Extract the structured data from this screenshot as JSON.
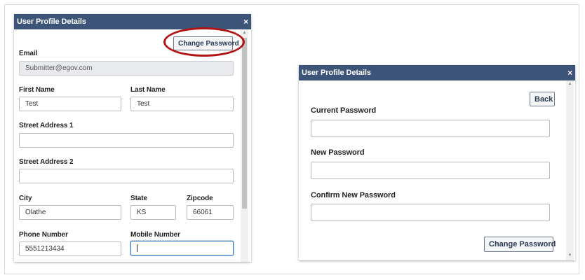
{
  "left_dialog": {
    "title": "User Profile Details",
    "close_glyph": "×",
    "change_password_label": "Change Password",
    "email": {
      "label": "Email",
      "value": "Submitter@egov.com"
    },
    "first_name": {
      "label": "First Name",
      "value": "Test"
    },
    "last_name": {
      "label": "Last Name",
      "value": "Test"
    },
    "street1": {
      "label": "Street Address 1",
      "value": ""
    },
    "street2": {
      "label": "Street Address 2",
      "value": ""
    },
    "city": {
      "label": "City",
      "value": "Olathe"
    },
    "state": {
      "label": "State",
      "value": "KS"
    },
    "zipcode": {
      "label": "Zipcode",
      "value": "66061"
    },
    "phone": {
      "label": "Phone Number",
      "value": "5551213434"
    },
    "mobile": {
      "label": "Mobile Number",
      "value": ""
    }
  },
  "right_dialog": {
    "title": "User Profile Details",
    "close_glyph": "×",
    "back_label": "Back",
    "current_password": {
      "label": "Current Password",
      "value": ""
    },
    "new_password": {
      "label": "New Password",
      "value": ""
    },
    "confirm_password": {
      "label": "Confirm New Password",
      "value": ""
    },
    "change_password_label": "Change Password"
  },
  "colors": {
    "titlebar": "#3c5478",
    "highlight_ring": "#b01414",
    "focus_border": "#3b7cc7"
  },
  "icons": {
    "close": "close-icon",
    "scroll_up": "scroll-up-arrow-icon",
    "scroll_down": "scroll-down-arrow-icon"
  }
}
